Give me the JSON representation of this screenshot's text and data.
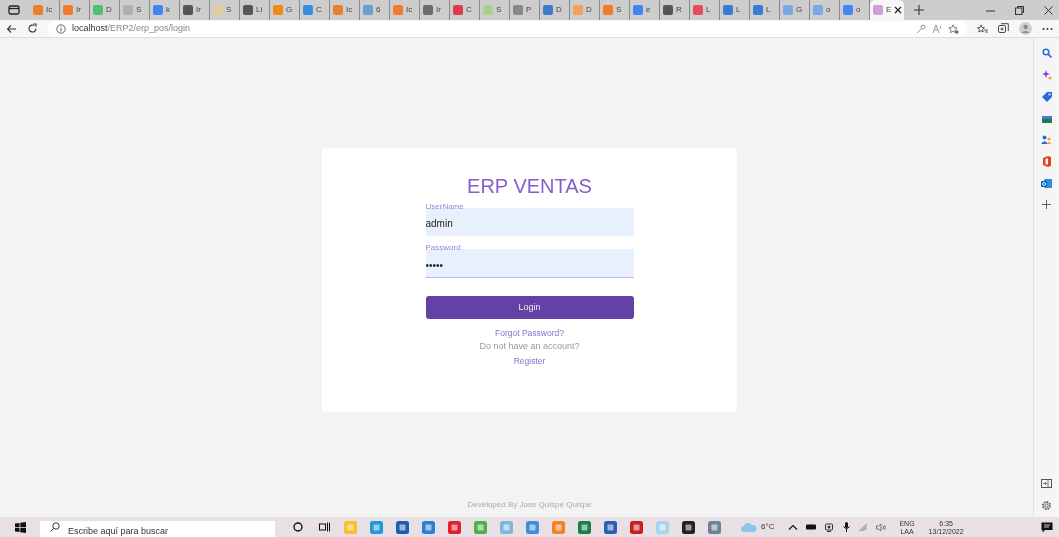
{
  "tabs": [
    {
      "label": "Ic",
      "color": "#e8822a",
      "selected": false
    },
    {
      "label": "Ir",
      "color": "#f07c2c",
      "selected": false
    },
    {
      "label": "D",
      "color": "#4fbf73",
      "selected": false
    },
    {
      "label": "S",
      "color": "#b0b0b0",
      "selected": false
    },
    {
      "label": "k",
      "color": "#4285f4",
      "selected": false
    },
    {
      "label": "Ir",
      "color": "#555555",
      "selected": false
    },
    {
      "label": "S",
      "color": "#e0cf9a",
      "selected": false
    },
    {
      "label": "Li",
      "color": "#555555",
      "selected": false
    },
    {
      "label": "G",
      "color": "#f08a1c",
      "selected": false
    },
    {
      "label": "C",
      "color": "#3a8ee0",
      "selected": false
    },
    {
      "label": "Ic",
      "color": "#e8822a",
      "selected": false
    },
    {
      "label": "6",
      "color": "#6a9fd0",
      "selected": false
    },
    {
      "label": "Ic",
      "color": "#f07c2c",
      "selected": false
    },
    {
      "label": "Ir",
      "color": "#6b6b6b",
      "selected": false
    },
    {
      "label": "C",
      "color": "#e03b4a",
      "selected": false
    },
    {
      "label": "S",
      "color": "#a8d08d",
      "selected": false
    },
    {
      "label": "P",
      "color": "#888888",
      "selected": false
    },
    {
      "label": "D",
      "color": "#3d7cc9",
      "selected": false
    },
    {
      "label": "D",
      "color": "#f0a060",
      "selected": false
    },
    {
      "label": "S",
      "color": "#f07c2c",
      "selected": false
    },
    {
      "label": "e",
      "color": "#4285f4",
      "selected": false
    },
    {
      "label": "R",
      "color": "#555555",
      "selected": false
    },
    {
      "label": "L",
      "color": "#e0505a",
      "selected": false
    },
    {
      "label": "L",
      "color": "#3a7bd5",
      "selected": false
    },
    {
      "label": "L",
      "color": "#3a7bd5",
      "selected": false
    },
    {
      "label": "G",
      "color": "#7aa7e8",
      "selected": false
    },
    {
      "label": "o",
      "color": "#7aa7e8",
      "selected": false
    },
    {
      "label": "o",
      "color": "#4285f4",
      "selected": false
    },
    {
      "label": "E",
      "color": "#c9a0dc",
      "selected": true
    }
  ],
  "address_bar": {
    "host": "localhost",
    "path": "/ERP2/erp_pos/login"
  },
  "login": {
    "title": "ERP VENTAS",
    "fields": [
      {
        "label": "UserName",
        "value": "admin",
        "focused": false
      },
      {
        "label": "Password",
        "value": "•••••",
        "focused": true
      }
    ],
    "button": "Login",
    "forgot_link": "Forgot Password?",
    "register_prompt": "Do not have an account?",
    "register_link": "Register"
  },
  "footer": "Developed By Jose Quispe Quispe",
  "taskbar": {
    "search_placeholder": "Escribe aquí para buscar",
    "apps": [
      {
        "kind": "cortana"
      },
      {
        "kind": "taskview"
      },
      {
        "kind": "app",
        "color": "#f6c12b"
      },
      {
        "kind": "app",
        "color": "#1f9bd7"
      },
      {
        "kind": "app",
        "color": "#1e5fb4"
      },
      {
        "kind": "app",
        "color": "#2a7fd4"
      },
      {
        "kind": "app",
        "color": "#e0202a"
      },
      {
        "kind": "app",
        "color": "#4caf50"
      },
      {
        "kind": "app",
        "color": "#7fb6e0"
      },
      {
        "kind": "app",
        "color": "#3f8fd8"
      },
      {
        "kind": "app",
        "color": "#f5821f"
      },
      {
        "kind": "app",
        "color": "#1d7b45"
      },
      {
        "kind": "app",
        "color": "#2b5fb5"
      },
      {
        "kind": "app",
        "color": "#c8201e"
      },
      {
        "kind": "app",
        "color": "#a9d4ef"
      },
      {
        "kind": "app",
        "color": "#222222"
      },
      {
        "kind": "app",
        "color": "#6f8296"
      }
    ],
    "temperature": "6°C",
    "language": "ENG",
    "layout": "LAA",
    "time": "6:35",
    "date": "13/12/2022"
  }
}
